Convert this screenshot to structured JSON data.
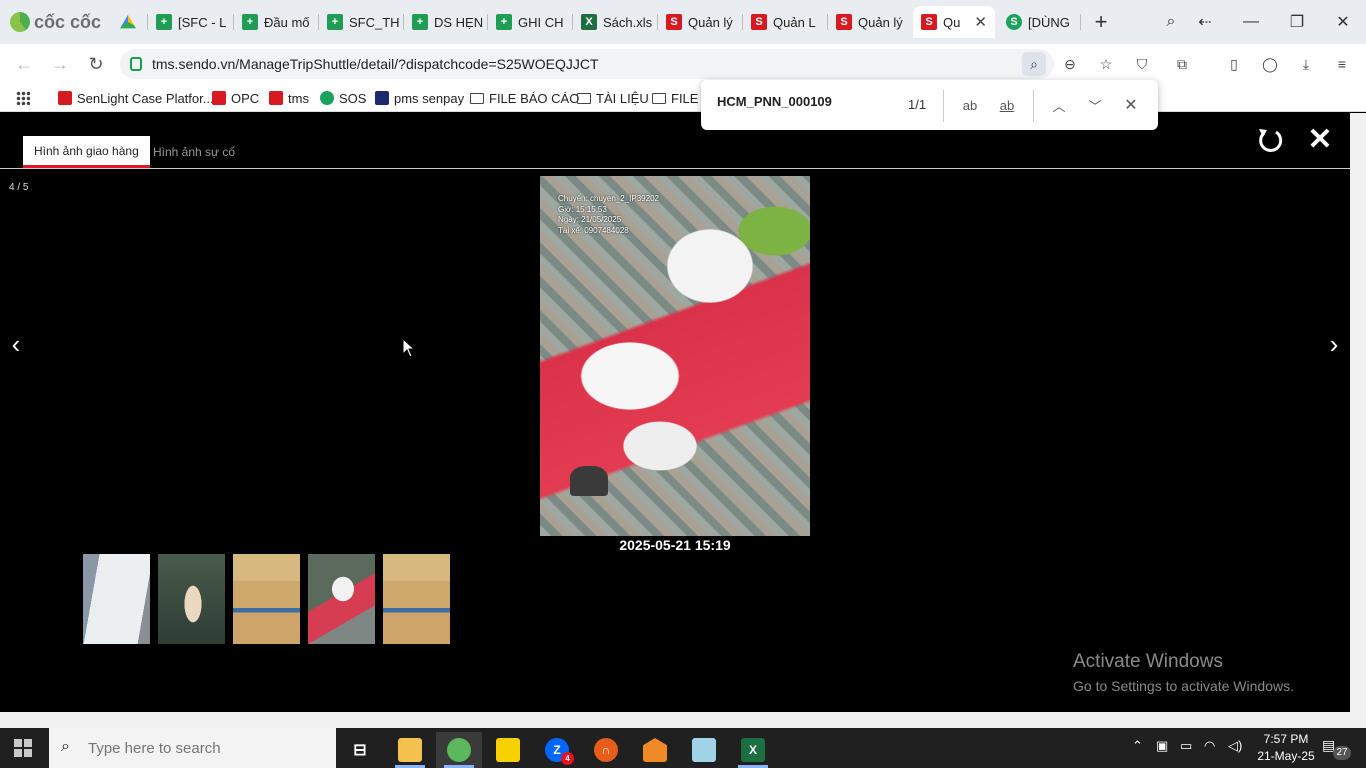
{
  "browser": {
    "brand": "cốc cốc",
    "tabs": [
      {
        "label": "",
        "icon": "drive-icon"
      },
      {
        "label": "[SFC - L",
        "icon": "sheets-icon"
      },
      {
        "label": "Đầu mố",
        "icon": "sheets-icon"
      },
      {
        "label": "SFC_TH",
        "icon": "sheets-icon"
      },
      {
        "label": "DS HẸN",
        "icon": "sheets-icon"
      },
      {
        "label": "GHI CH",
        "icon": "sheets-icon"
      },
      {
        "label": "Sách.xls",
        "icon": "excel-icon"
      },
      {
        "label": "Quản lý",
        "icon": "sendo-icon"
      },
      {
        "label": "Quản L",
        "icon": "sendo-icon"
      },
      {
        "label": "Quản lý",
        "icon": "sendo-icon"
      },
      {
        "label": "Qu",
        "icon": "sendo-icon",
        "active": true
      },
      {
        "label": "[DÙNG",
        "icon": "green-icon"
      }
    ],
    "url": "tms.sendo.vn/ManageTripShuttle/detail/?dispatchcode=S25WOEQJJCT",
    "bookmarks": [
      {
        "label": "SenLight Case Platfor...",
        "icon": "sendo-icon"
      },
      {
        "label": "OPC",
        "icon": "sendo-icon"
      },
      {
        "label": "tms",
        "icon": "sendo-icon"
      },
      {
        "label": "SOS",
        "icon": "green-icon"
      },
      {
        "label": "pms senpay",
        "icon": "p-icon"
      },
      {
        "label": "FILE BÁO CÁO",
        "icon": "folder-icon"
      },
      {
        "label": "TÀI LIỆU",
        "icon": "folder-icon"
      },
      {
        "label": "FILE C",
        "icon": "folder-icon"
      }
    ],
    "find": {
      "query": "HCM_PNN_000109",
      "count": "1/1",
      "match_case_label": "ab",
      "whole_word_label": "ab"
    }
  },
  "viewer": {
    "tabs": [
      "Hình ảnh giao hàng",
      "Hình ảnh sự cố"
    ],
    "counter": "4 / 5",
    "prev": "‹",
    "next": "›",
    "close": "✕",
    "photo_overlay": [
      "Chuyến: chuyen_2_IP39202",
      "Giờ: 15:15:53",
      "Ngày: 21/05/2025",
      "Tài xế: 0907484028"
    ],
    "caption": "2025-05-21 15:19",
    "thumbnail_count": 5
  },
  "watermark": {
    "title": "Activate Windows",
    "subtitle": "Go to Settings to activate Windows."
  },
  "taskbar": {
    "search_placeholder": "Type here to search",
    "zalo_badge": "4",
    "time": "7:57 PM",
    "date": "21-May-25",
    "notification_count": "27"
  },
  "colors": {
    "accent_red": "#e0182d",
    "sheets_green": "#1f9d55",
    "excel_green": "#1d6f42",
    "sendo_red": "#d71920"
  }
}
